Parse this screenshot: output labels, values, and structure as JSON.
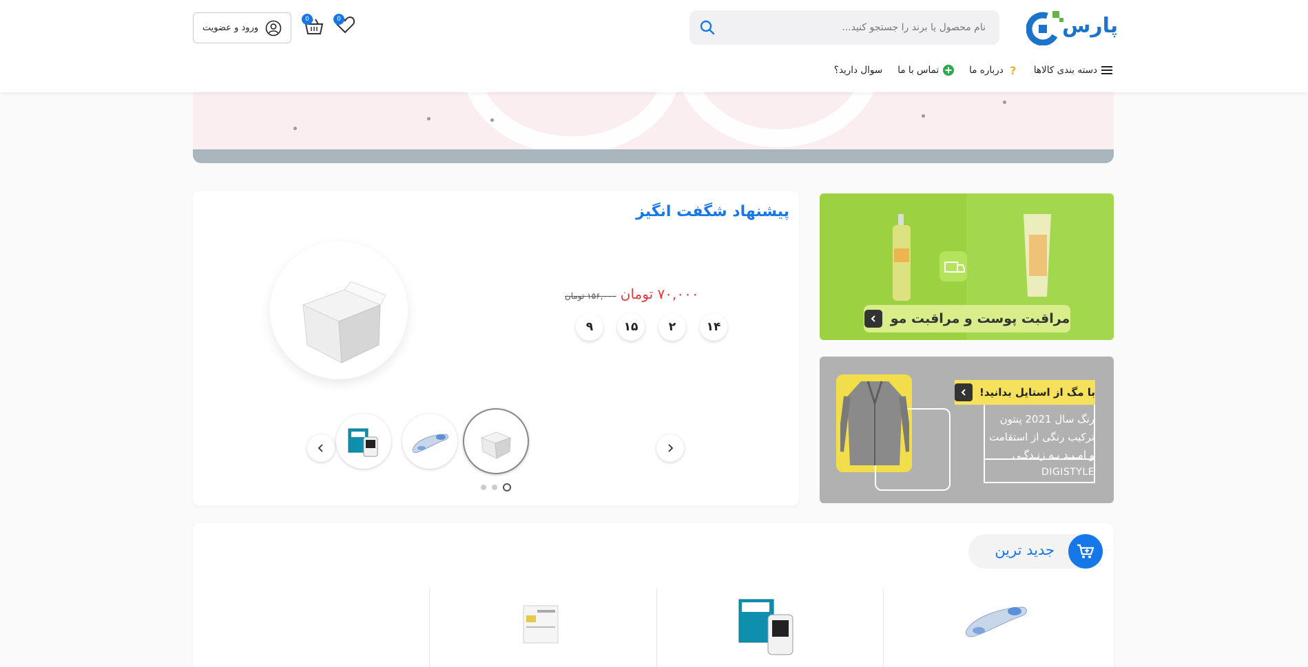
{
  "header": {
    "logo_text": "پارس",
    "search": {
      "placeholder": "نام محصول یا برند را جستجو کنید..."
    },
    "wishlist_count": "0",
    "cart_count": "0",
    "login_label": "ورود و عضویت"
  },
  "nav": {
    "items": [
      {
        "label": "دسته بندی کالاها",
        "icon": "hamburger-icon"
      },
      {
        "label": "درباره ما",
        "icon": "question-icon"
      },
      {
        "label": "تماس با ما",
        "icon": "plus-circle-icon"
      },
      {
        "label": "سوال دارید؟",
        "icon": ""
      }
    ]
  },
  "offer": {
    "title": "پیشنهاد شگفت انگیز",
    "new_price": "۷۰,۰۰۰ تومان",
    "old_price": "۱۵۶,۰۰۰ تومان",
    "countdown": [
      "۹",
      "۱۵",
      "۲",
      "۱۴"
    ],
    "pager_total": 3,
    "pager_active": 3
  },
  "banners": {
    "skin_care_label": "مراقبت پوست و مراقبت مو",
    "style_head": "با مگ از استایل بدانید!",
    "style_lines": [
      "رنگ سال 2021 پنتون",
      "ترکیب رنگی از استقامت",
      "و امـیـد بـه زنـدگـی"
    ],
    "style_brand": "DIGISTYLE"
  },
  "newest": {
    "title": "جدید ترین"
  },
  "colors": {
    "primary": "#1677e8",
    "price_red": "#e0393e",
    "banner_green": "#9cd142",
    "banner_yellow": "#f6e15d"
  }
}
